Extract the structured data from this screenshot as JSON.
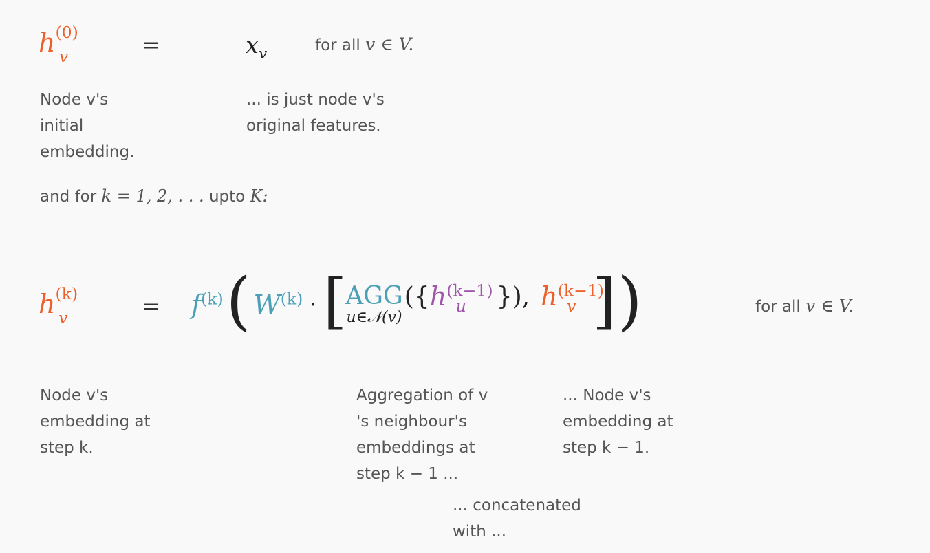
{
  "base": {
    "lhs_letter": "h",
    "lhs_sup": "(0)",
    "lhs_sub": "v",
    "equals": "=",
    "rhs_letter": "x",
    "rhs_sub": "v",
    "forall_text": "for all",
    "forall_math": "v ∈ V.",
    "ann_left_lines": [
      "Node v's",
      "initial",
      "embedding."
    ],
    "ann_right_lines": [
      "... is just node v's",
      "original features."
    ]
  },
  "loop_line": {
    "text": "and for",
    "math": "k = 1, 2, . . .",
    "upto": "upto",
    "K": "K:"
  },
  "step": {
    "lhs_letter": "h",
    "lhs_sup": "(k)",
    "lhs_sub": "v",
    "equals": "=",
    "f_letter": "f",
    "f_sup": "(k)",
    "lparen": "(",
    "W_letter": "W",
    "W_sup": "(k)",
    "dot": "·",
    "lbracket": "[",
    "agg": "AGG",
    "agg_sub": "u∈𝒩(v)",
    "open_set": "({",
    "hu_letter": "h",
    "hu_sup": "(k−1)",
    "hu_sub": "u",
    "close_set": "}),",
    "hv_letter": "h",
    "hv_sup": "(k−1)",
    "hv_sub": "v",
    "rbracket": "]",
    "rparen": ")",
    "forall_text": "for all",
    "forall_math": "v ∈ V.",
    "ann_left_lines": [
      "Node v's",
      "embedding at",
      "step k."
    ],
    "ann_agg_lines": [
      "Aggregation of v",
      "'s neighbour's",
      "embeddings at",
      "step k − 1 ..."
    ],
    "ann_prev_lines": [
      "... Node v's",
      "embedding at",
      "step k − 1."
    ],
    "ann_concat_lines": [
      "... concatenated",
      "with ..."
    ]
  },
  "colors": {
    "embedding": "#ef5f2a",
    "transform": "#4b9fb6",
    "neighbour": "#a056a8"
  }
}
